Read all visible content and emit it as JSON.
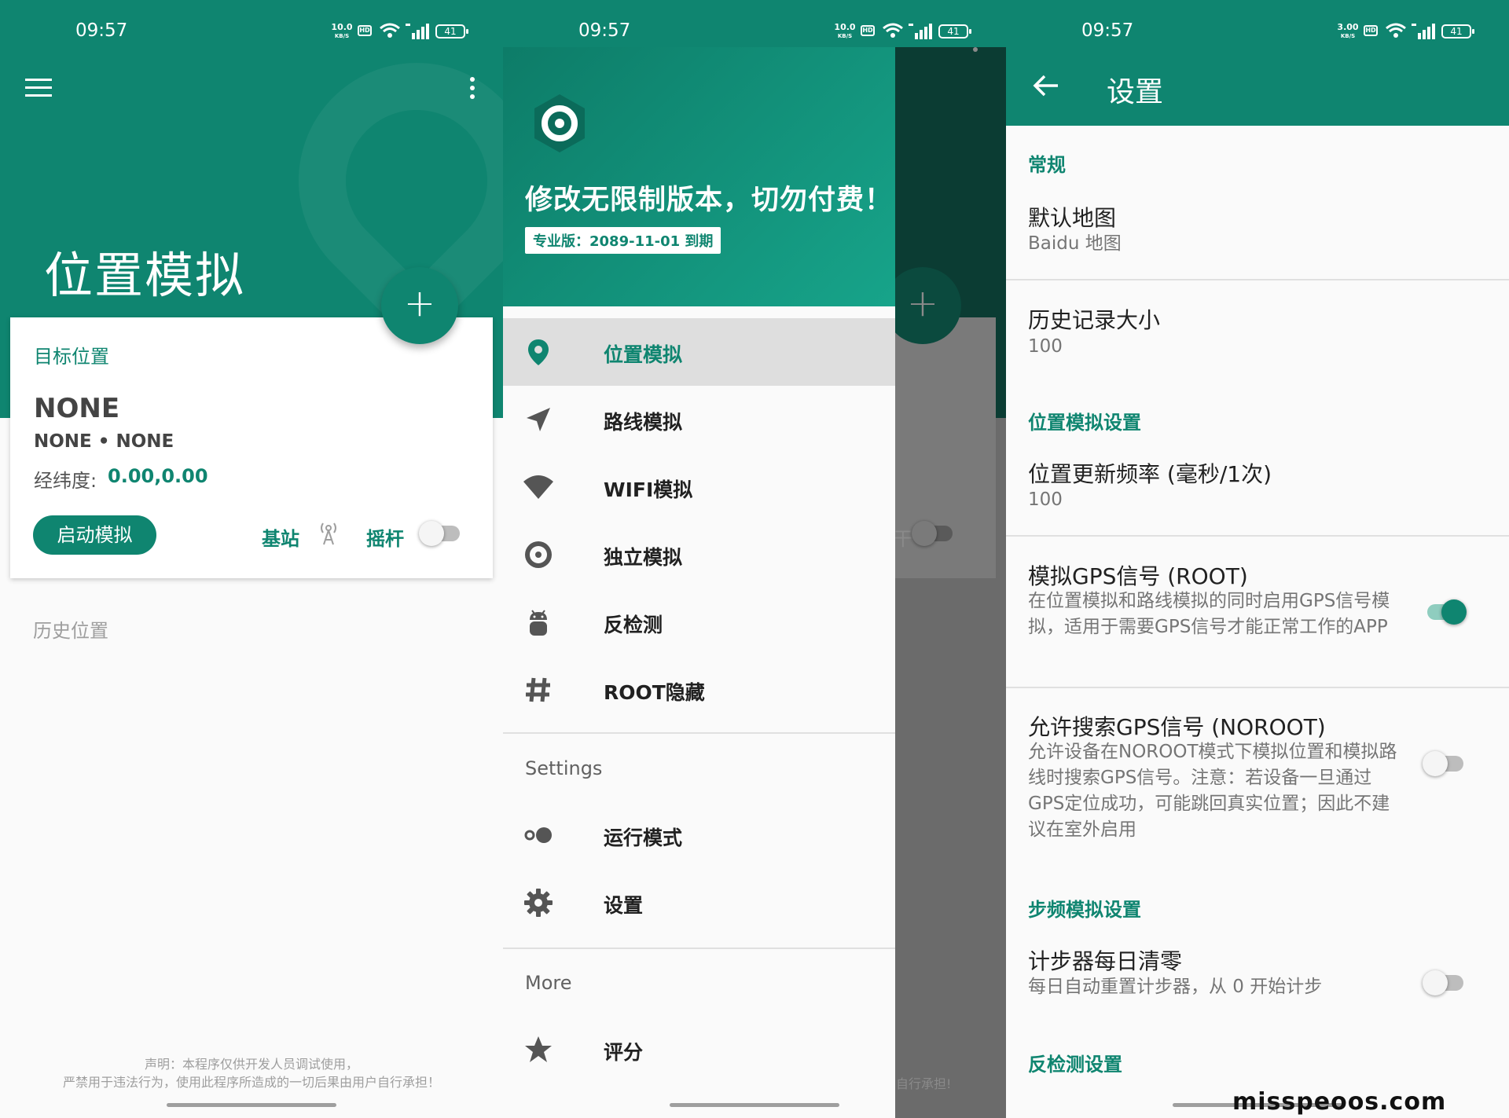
{
  "status_bar": {
    "panels": [
      {
        "time": "09:57",
        "net_rate": "10.0",
        "net_unit": "KB/S",
        "hd": "HD",
        "battery": "41"
      },
      {
        "time": "09:57",
        "net_rate": "10.0",
        "net_unit": "KB/S",
        "hd": "HD",
        "battery": "41"
      },
      {
        "time": "09:57",
        "net_rate": "3.00",
        "net_unit": "KB/S",
        "hd": "HD",
        "battery": "41"
      }
    ]
  },
  "main": {
    "title": "位置模拟",
    "fab_label": "+",
    "target_card": {
      "title": "目标位置",
      "location_name": "NONE",
      "location_sub": "NONE • NONE",
      "coord_label": "经纬度:",
      "coord_value": "0.00,0.00",
      "start_button": "启动模拟",
      "base_station_label": "基站",
      "joystick_label": "摇杆",
      "joystick_enabled": false
    },
    "history_label": "历史位置",
    "disclaimer_line1": "声明：本程序仅供开发人员调试使用，",
    "disclaimer_line2": "严禁用于违法行为，使用此程序所造成的一切后果由用户自行承担！"
  },
  "drawer": {
    "slogan": "修改无限制版本，切勿付费！",
    "badge": "专业版：2089-11-01 到期",
    "items": [
      {
        "label": "位置模拟",
        "icon": "location-pin-icon",
        "active": true
      },
      {
        "label": "路线模拟",
        "icon": "navigation-arrow-icon",
        "active": false
      },
      {
        "label": "WIFI模拟",
        "icon": "wifi-icon",
        "active": false
      },
      {
        "label": "独立模拟",
        "icon": "disc-icon",
        "active": false
      },
      {
        "label": "反检测",
        "icon": "android-icon",
        "active": false
      },
      {
        "label": "ROOT隐藏",
        "icon": "hash-icon",
        "active": false
      }
    ],
    "settings_section": "Settings",
    "settings_items": [
      {
        "label": "运行模式",
        "icon": "toggle-dots-icon"
      },
      {
        "label": "设置",
        "icon": "gear-icon"
      }
    ],
    "more_section": "More",
    "more_items": [
      {
        "label": "评分",
        "icon": "star-icon"
      }
    ],
    "background_fragments": {
      "fab": "+",
      "toggle_label_fragment": "干",
      "disclaimer_fragment": "自行承担!"
    }
  },
  "settings": {
    "title": "设置",
    "general_category": "常规",
    "default_map_title": "默认地图",
    "default_map_value": "Baidu 地图",
    "history_size_title": "历史记录大小",
    "history_size_value": "100",
    "location_category": "位置模拟设置",
    "update_rate_title": "位置更新频率 (毫秒/1次)",
    "update_rate_value": "100",
    "gps_signal_title": "模拟GPS信号 (ROOT)",
    "gps_signal_desc": "在位置模拟和路线模拟的同时启用GPS信号模拟，适用于需要GPS信号才能正常工作的APP",
    "gps_signal_enabled": true,
    "gps_search_title": "允许搜索GPS信号 (NOROOT)",
    "gps_search_desc": "允许设备在NOROOT模式下模拟位置和模拟路线时搜索GPS信号。注意：若设备一旦通过GPS定位成功，可能跳回真实位置；因此不建议在室外启用",
    "gps_search_enabled": false,
    "step_category": "步频模拟设置",
    "step_reset_title": "计步器每日清零",
    "step_reset_desc": "每日自动重置计步器，从 0 开始计步",
    "step_reset_enabled": false,
    "anti_detect_category": "反检测设置"
  },
  "watermark": "misspeoos.com",
  "colors": {
    "primary": "#0f8570",
    "primary_light": "#17a48a",
    "scrim": "#6b6b6b"
  }
}
